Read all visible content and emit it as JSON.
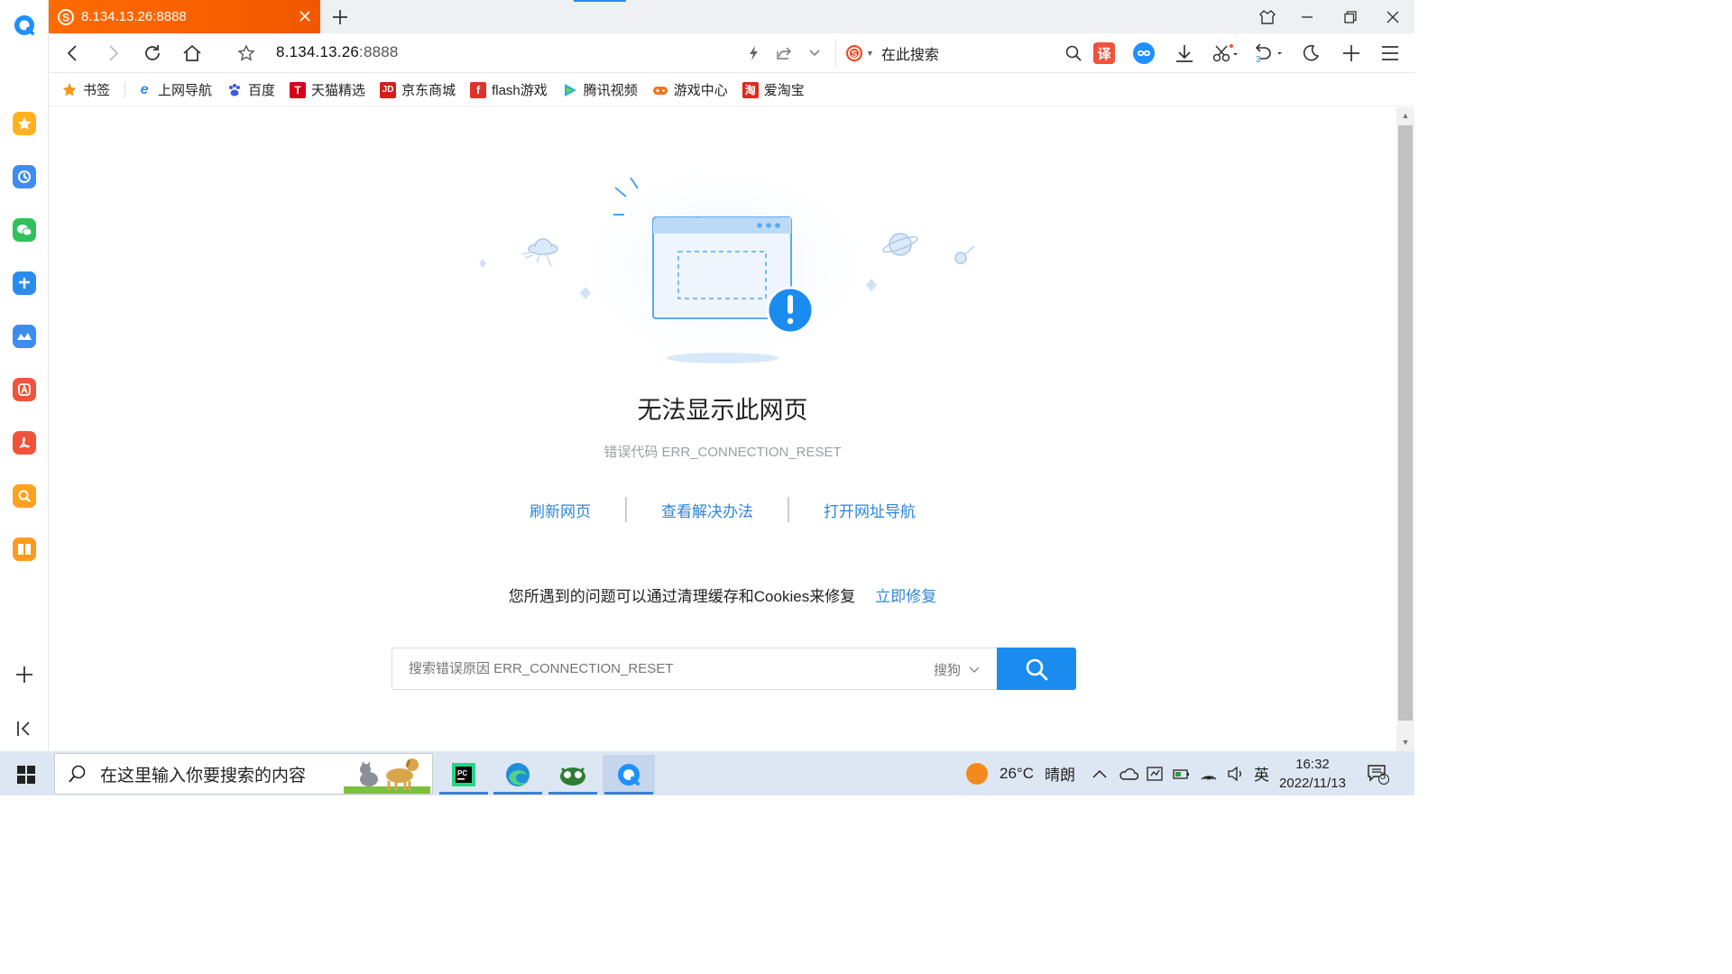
{
  "tab": {
    "title": "8.134.13.26:8888"
  },
  "address": {
    "host": "8.134.13.26",
    "port": ":8888"
  },
  "search": {
    "placeholder": "在此搜索"
  },
  "bookmarks": [
    {
      "label": "书签",
      "icon": "star-icon",
      "color": "#f39a1e"
    },
    {
      "label": "上网导航",
      "icon": "ie-icon",
      "color": "#2d8ae8"
    },
    {
      "label": "百度",
      "icon": "baidu-paw-icon",
      "color": "#3b5bdb"
    },
    {
      "label": "天猫精选",
      "icon": "tmall-icon",
      "color": "#d6001c"
    },
    {
      "label": "京东商城",
      "icon": "jd-icon",
      "color": "#d71c1c"
    },
    {
      "label": "flash游戏",
      "icon": "flash-icon",
      "color": "#e2312b"
    },
    {
      "label": "腾讯视频",
      "icon": "tencent-video-icon",
      "color": "#20b2f3"
    },
    {
      "label": "游戏中心",
      "icon": "gamepad-icon",
      "color": "#f07320"
    },
    {
      "label": "爱淘宝",
      "icon": "taobao-icon",
      "color": "#e0281f"
    }
  ],
  "error": {
    "title": "无法显示此网页",
    "code": "错误代码 ERR_CONNECTION_RESET",
    "links": [
      "刷新网页",
      "查看解决办法",
      "打开网址导航"
    ],
    "fix_text": "您所遇到的问题可以通过清理缓存和Cookies来修复",
    "fix_link": "立即修复",
    "search_placeholder": "搜索错误原因 ERR_CONNECTION_RESET",
    "engine": "搜狗"
  },
  "taskbar": {
    "search_text": "在这里输入你要搜索的内容",
    "weather_temp": "26°C",
    "weather_desc": "晴朗",
    "ime": "英",
    "time": "16:32",
    "date": "2022/11/13",
    "notif_count": "5"
  },
  "undo_badge": "3",
  "colors": {
    "accent": "#2f85d8",
    "tab": "#f25800",
    "search_btn": "#1a8cf0"
  }
}
